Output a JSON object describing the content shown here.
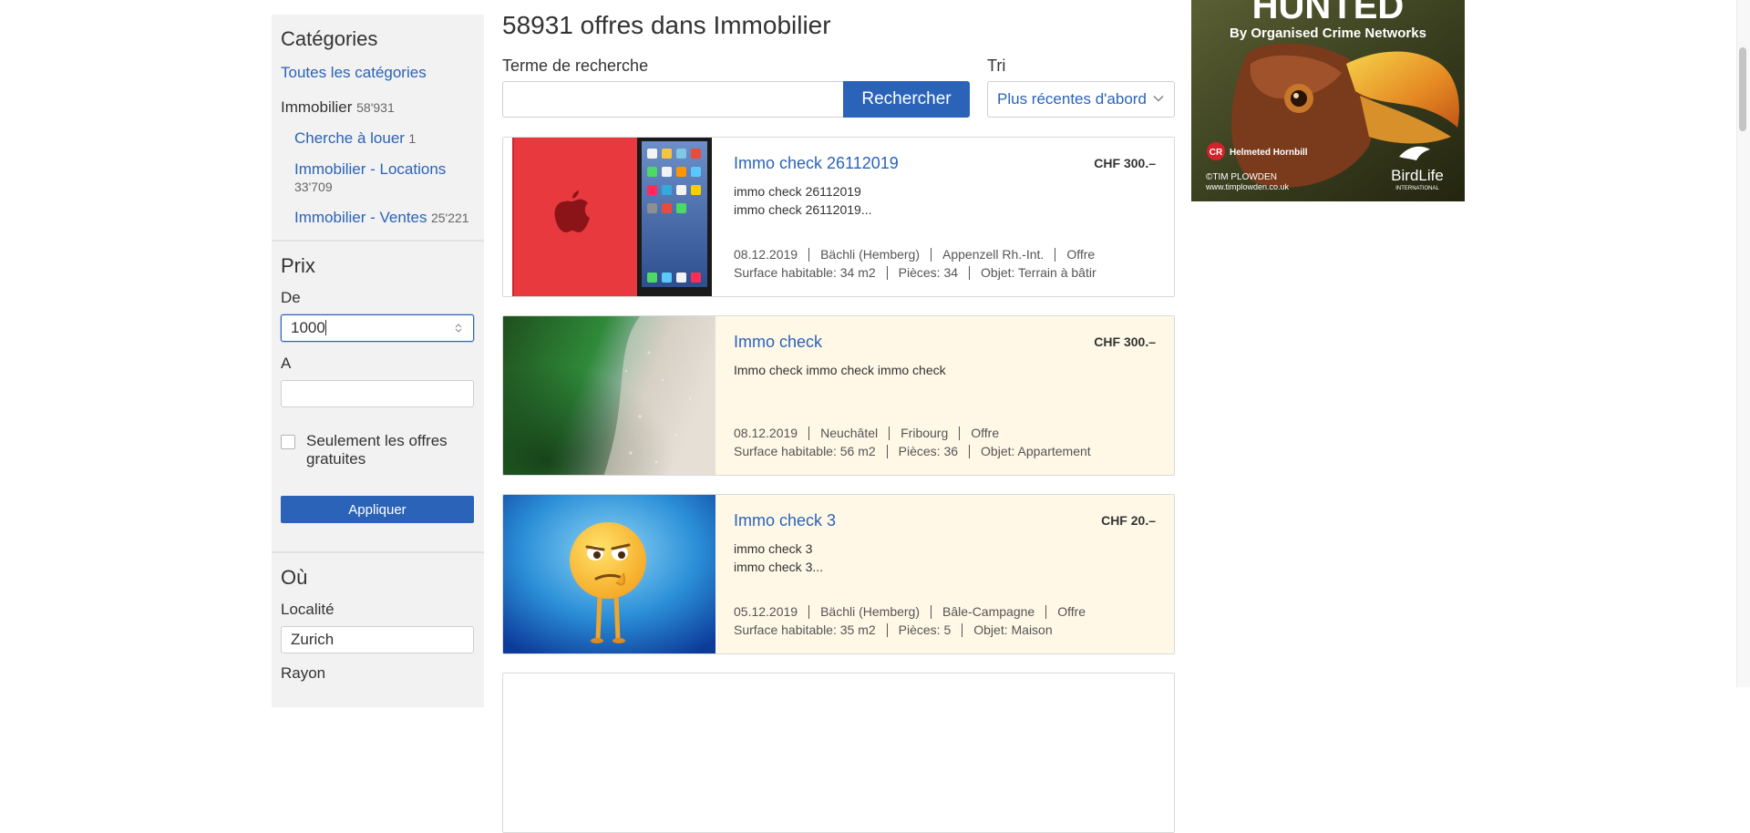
{
  "sidebar": {
    "categories_title": "Catégories",
    "all_categories": "Toutes les catégories",
    "current_category": {
      "label": "Immobilier",
      "count": "58'931"
    },
    "subcategories": [
      {
        "label": "Cherche à louer",
        "count": "1"
      },
      {
        "label": "Immobilier - Locations",
        "count": "33'709"
      },
      {
        "label": "Immobilier - Ventes",
        "count": "25'221"
      }
    ],
    "price": {
      "title": "Prix",
      "from_label": "De",
      "from_value": "1000",
      "to_label": "A",
      "to_value": "",
      "free_only_label": "Seulement les offres gratuites",
      "apply_label": "Appliquer"
    },
    "where": {
      "title": "Où",
      "locality_label": "Localité",
      "locality_value": "Zurich",
      "radius_label": "Rayon"
    }
  },
  "main": {
    "title": "58931 offres dans Immobilier",
    "search": {
      "label": "Terme de recherche",
      "value": "",
      "button": "Rechercher"
    },
    "sort": {
      "label": "Tri",
      "selected": "Plus récentes d'abord"
    },
    "listings": [
      {
        "title": "Immo check 26112019",
        "price": "CHF 300.–",
        "desc": [
          "immo check 26112019",
          "immo check 26112019..."
        ],
        "meta1": [
          "08.12.2019",
          "Bächli (Hemberg)",
          "Appenzell Rh.-Int.",
          "Offre"
        ],
        "meta2": [
          "Surface habitable: 34 m2",
          "Pièces: 34",
          "Objet: Terrain à bâtir"
        ],
        "image": "red-tablet"
      },
      {
        "title": "Immo check",
        "price": "CHF 300.–",
        "desc": [
          "Immo check immo check immo check"
        ],
        "meta1": [
          "08.12.2019",
          "Neuchâtel",
          "Fribourg",
          "Offre"
        ],
        "meta2": [
          "Surface habitable: 56 m2",
          "Pièces: 36",
          "Objet: Appartement"
        ],
        "image": "green-abstract"
      },
      {
        "title": "Immo check 3",
        "price": "CHF 20.–",
        "desc": [
          "immo check 3",
          "immo check 3..."
        ],
        "meta1": [
          "05.12.2019",
          "Bächli (Hemberg)",
          "Bâle-Campagne",
          "Offre"
        ],
        "meta2": [
          "Surface habitable: 35 m2",
          "Pièces: 5",
          "Objet: Maison"
        ],
        "image": "emoji-character"
      }
    ]
  },
  "ad": {
    "headline": "HUNTED",
    "subline": "By Organised Crime Networks",
    "cr_badge": "CR",
    "species": "Helmeted Hornbill",
    "credit": "©TIM PLOWDEN",
    "credit_url": "www.timplowden.co.uk",
    "brand": "BirdLife",
    "brand_sub": "INTERNATIONAL"
  },
  "colors": {
    "accent": "#2a63b8",
    "sidebar_bg": "#f2f2f2",
    "highlight_listing_bg": "#fff8e7"
  }
}
